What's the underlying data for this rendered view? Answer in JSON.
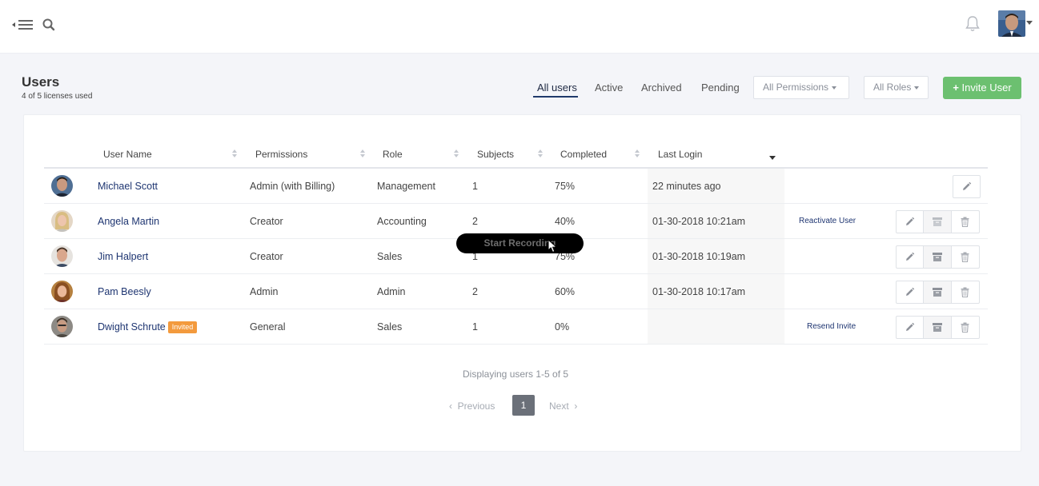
{
  "header": {
    "menu_icon": "menu-collapse-icon",
    "search_icon": "search-icon",
    "bell_icon": "bell-icon"
  },
  "page": {
    "title": "Users",
    "subtitle": "4 of 5 licenses used"
  },
  "tabs": [
    {
      "label": "All users",
      "active": true
    },
    {
      "label": "Active",
      "active": false
    },
    {
      "label": "Archived",
      "active": false
    },
    {
      "label": "Pending",
      "active": false
    }
  ],
  "filters": {
    "permissions": "All Permissions",
    "roles": "All Roles"
  },
  "invite_button": {
    "plus": "+",
    "label": "Invite User"
  },
  "table": {
    "columns": [
      "User Name",
      "Permissions",
      "Role",
      "Subjects",
      "Completed",
      "Last Login"
    ],
    "rows": [
      {
        "name": "Michael Scott",
        "badge": "",
        "permissions": "Admin (with Billing)",
        "role": "Management",
        "subjects": "1",
        "completed": "75%",
        "last_login": "22 minutes ago",
        "link": ""
      },
      {
        "name": "Angela Martin",
        "badge": "",
        "permissions": "Creator",
        "role": "Accounting",
        "subjects": "2",
        "completed": "40%",
        "last_login": "01-30-2018 10:21am",
        "link": "Reactivate User"
      },
      {
        "name": "Jim Halpert",
        "badge": "",
        "permissions": "Creator",
        "role": "Sales",
        "subjects": "1",
        "completed": "75%",
        "last_login": "01-30-2018 10:19am",
        "link": ""
      },
      {
        "name": "Pam Beesly",
        "badge": "",
        "permissions": "Admin",
        "role": "Admin",
        "subjects": "2",
        "completed": "60%",
        "last_login": "01-30-2018 10:17am",
        "link": ""
      },
      {
        "name": "Dwight Schrute",
        "badge": "Invited",
        "permissions": "General",
        "role": "Sales",
        "subjects": "1",
        "completed": "0%",
        "last_login": "",
        "link": "Resend Invite"
      }
    ]
  },
  "overlay": {
    "recording_label": "Start Recording"
  },
  "pagination": {
    "display_text": "Displaying users 1-5 of 5",
    "previous": "Previous",
    "current": "1",
    "next": "Next"
  },
  "colors": {
    "accent_green": "#6cc070",
    "link_navy": "#1e3571",
    "badge_orange": "#f39a3d"
  }
}
